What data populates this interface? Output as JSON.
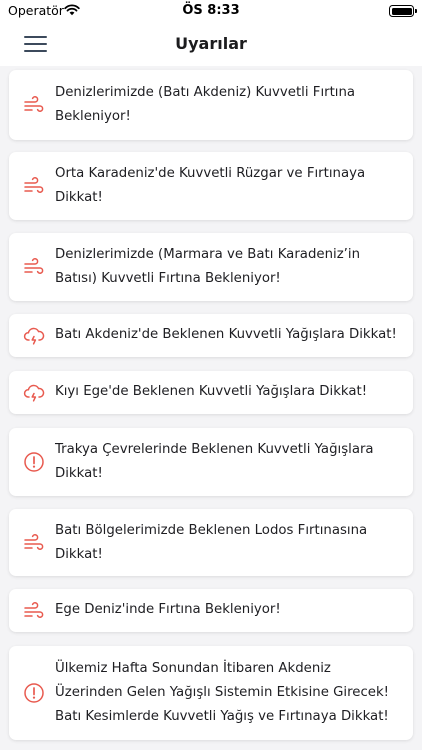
{
  "status_bar": {
    "carrier": "Operatör",
    "time": "ÖS 8:33"
  },
  "nav": {
    "title": "Uyarılar",
    "menu_icon": "hamburger-menu-icon"
  },
  "colors": {
    "accent": "#e85a4f",
    "background": "#f4f4f6",
    "card": "#ffffff"
  },
  "alerts": [
    {
      "icon": "wind-icon",
      "text": "Denizlerimizde (Batı Akdeniz) Kuvvetli Fırtına\nBekleniyor!"
    },
    {
      "icon": "wind-icon",
      "text": "Orta Karadeniz'de Kuvvetli Rüzgar ve Fırtınaya\nDikkat!"
    },
    {
      "icon": "wind-icon",
      "text": "Denizlerimizde (Marmara ve Batı Karadeniz’in\nBatısı) Kuvvetli Fırtına Bekleniyor!"
    },
    {
      "icon": "rain-cloud-icon",
      "text": "Batı Akdeniz'de Beklenen Kuvvetli Yağışlara Dikkat!"
    },
    {
      "icon": "rain-cloud-icon",
      "text": "Kıyı Ege'de Beklenen Kuvvetli Yağışlara Dikkat!"
    },
    {
      "icon": "info-icon",
      "text": "Trakya Çevrelerinde Beklenen Kuvvetli Yağışlara\nDikkat!"
    },
    {
      "icon": "wind-icon",
      "text": "Batı Bölgelerimizde Beklenen Lodos Fırtınasına\nDikkat!"
    },
    {
      "icon": "wind-icon",
      "text": "Ege Deniz'inde Fırtına Bekleniyor!"
    },
    {
      "icon": "info-icon",
      "text": "Ülkemiz Hafta Sonundan İtibaren Akdeniz\nÜzerinden Gelen Yağışlı Sistemin Etkisine Girecek!\nBatı Kesimlerde Kuvvetli Yağış ve Fırtınaya Dikkat!"
    }
  ]
}
